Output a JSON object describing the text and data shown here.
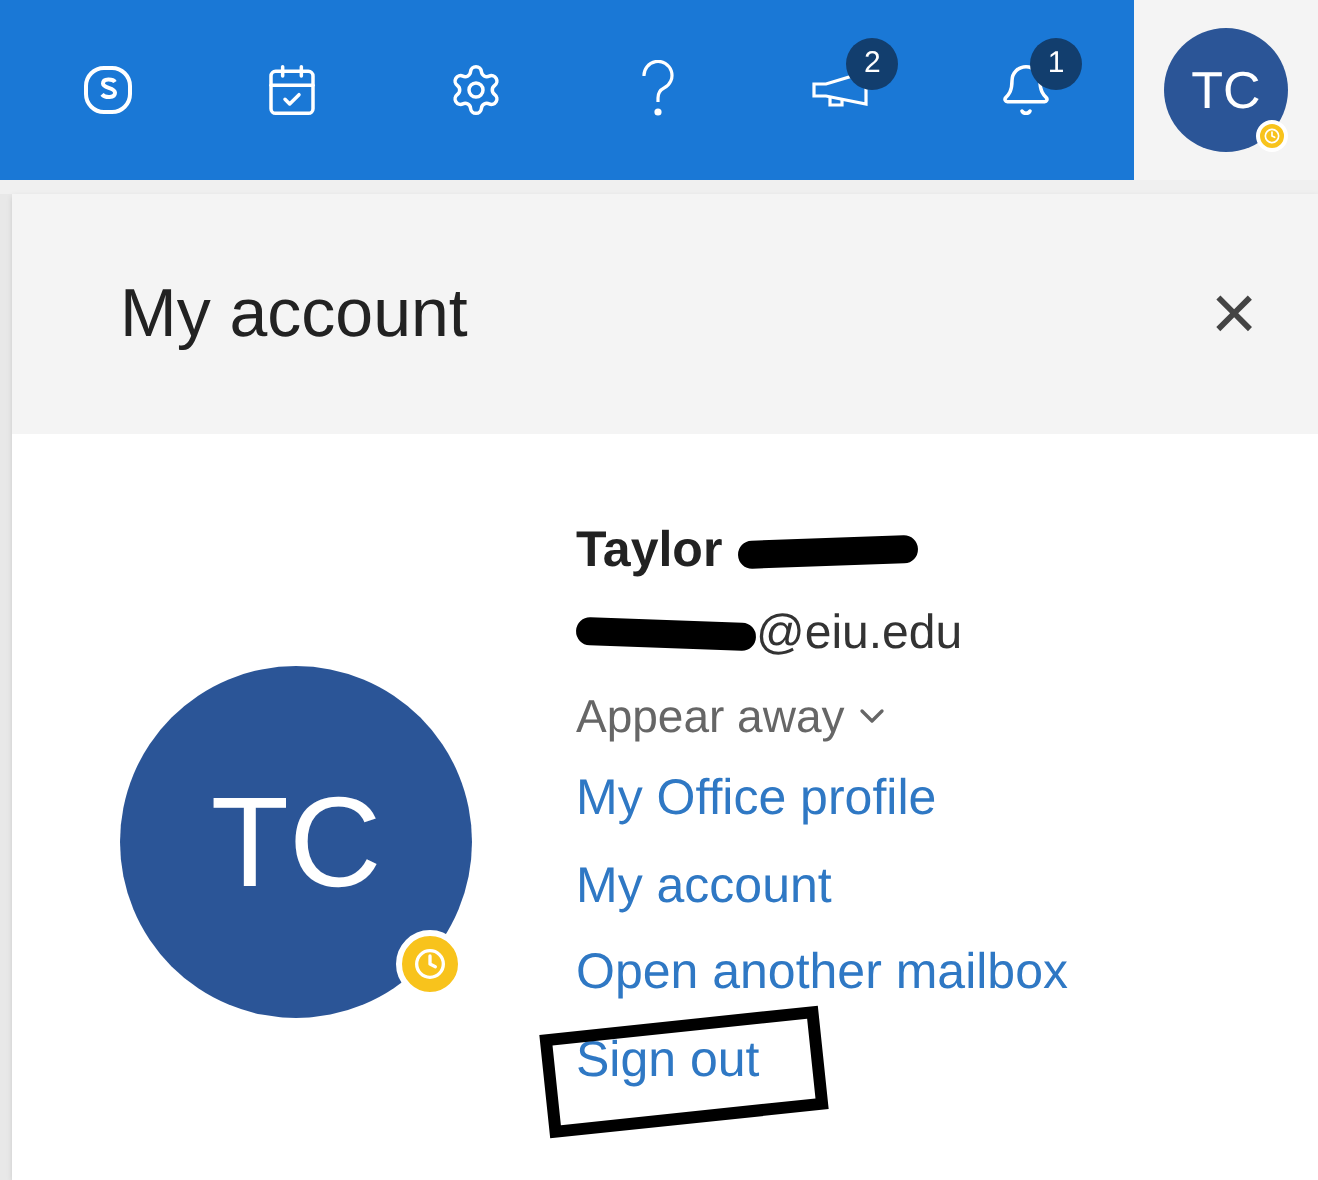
{
  "toolbar": {
    "items": [
      {
        "kind": "skype"
      },
      {
        "kind": "calendar"
      },
      {
        "kind": "settings"
      },
      {
        "kind": "help"
      },
      {
        "kind": "megaphone",
        "badge": "2"
      },
      {
        "kind": "bell",
        "badge": "1"
      }
    ],
    "avatar": {
      "initials": "TC",
      "away": true
    }
  },
  "panel": {
    "title": "My account",
    "close": "×",
    "avatar": {
      "initials": "TC",
      "away": true
    },
    "name": "Taylor",
    "email": "@eiu.edu",
    "presence": "Appear away",
    "links": [
      {
        "label": "My Office profile",
        "framed": false
      },
      {
        "label": "My account",
        "framed": false
      },
      {
        "label": "Open another mailbox",
        "framed": false
      },
      {
        "label": "Sign out",
        "framed": true
      }
    ]
  }
}
